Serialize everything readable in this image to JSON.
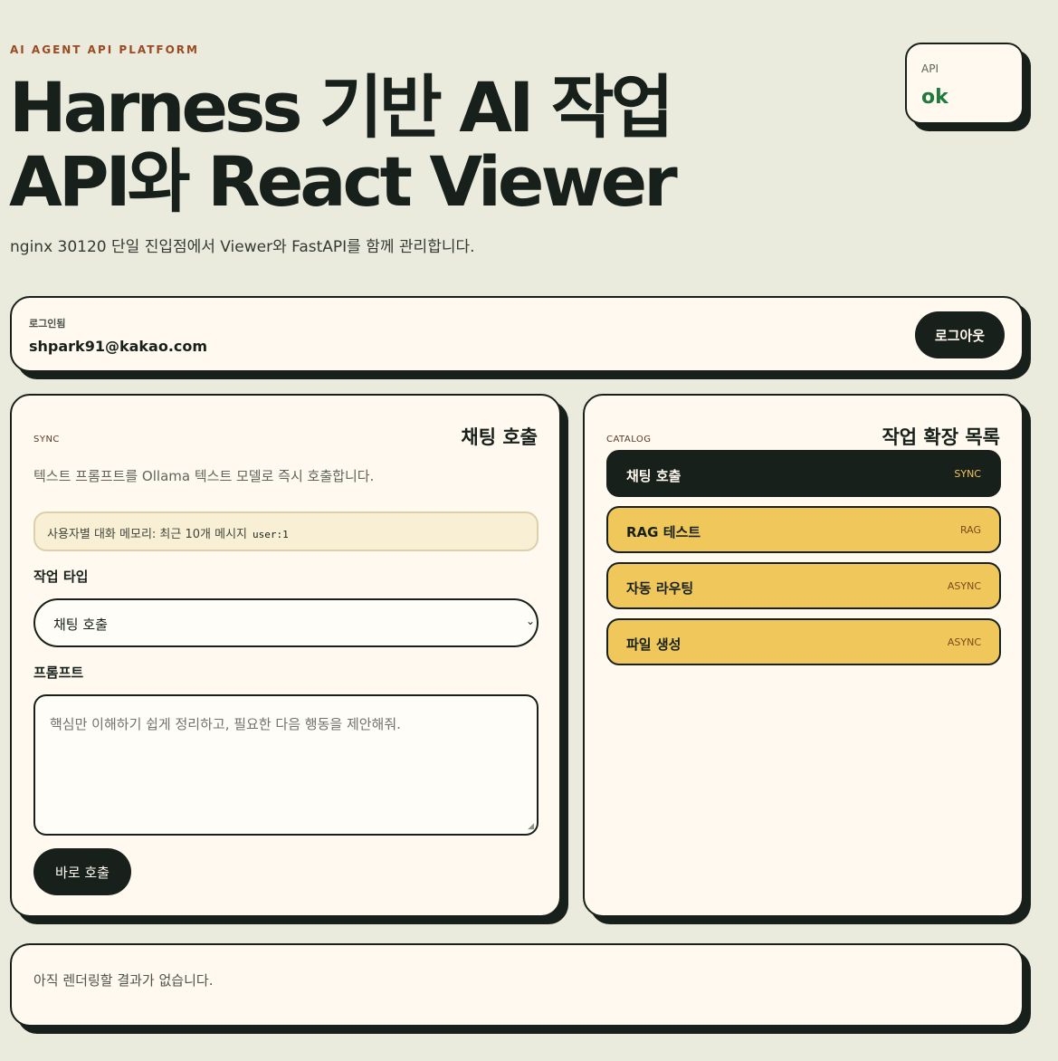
{
  "header": {
    "eyebrow": "AI AGENT API PLATFORM",
    "title_line1": "Harness 기반 AI 작업",
    "title_line2": "API와 React Viewer",
    "subtitle": "nginx 30120 단일 진입점에서 Viewer와 FastAPI를 함께 관리합니다."
  },
  "api_status": {
    "label": "API",
    "value": "ok",
    "color": "#1f7a3c"
  },
  "login": {
    "label": "로그인됨",
    "email": "shpark91@kakao.com",
    "logout_label": "로그아웃"
  },
  "chat_panel": {
    "tag": "SYNC",
    "title": "채팅 호출",
    "description": "텍스트 프롬프트를 Ollama 텍스트 모델로 즉시 호출합니다.",
    "memory_text": "사용자별 대화 메모리: 최근 10개 메시지",
    "memory_user": "user:1",
    "type_label": "작업 타입",
    "type_selected": "채팅 호출",
    "prompt_label": "프롬프트",
    "prompt_placeholder": "핵심만 이해하기 쉽게 정리하고, 필요한 다음 행동을 제안해줘.",
    "run_label": "바로 호출"
  },
  "catalog": {
    "tag": "CATALOG",
    "title": "작업 확장 목록",
    "items": [
      {
        "label": "채팅 호출",
        "mode": "SYNC",
        "active": true
      },
      {
        "label": "RAG 테스트",
        "mode": "RAG",
        "active": false
      },
      {
        "label": "자동 라우팅",
        "mode": "ASYNC",
        "active": false
      },
      {
        "label": "파일 생성",
        "mode": "ASYNC",
        "active": false
      }
    ]
  },
  "result": {
    "empty_text": "아직 렌더링할 결과가 없습니다."
  },
  "colors": {
    "background": "#ebebdd",
    "ink": "#17201a",
    "card": "#fff9ef",
    "accent_yellow": "#f0c75a",
    "eyebrow": "#9a4a22"
  }
}
